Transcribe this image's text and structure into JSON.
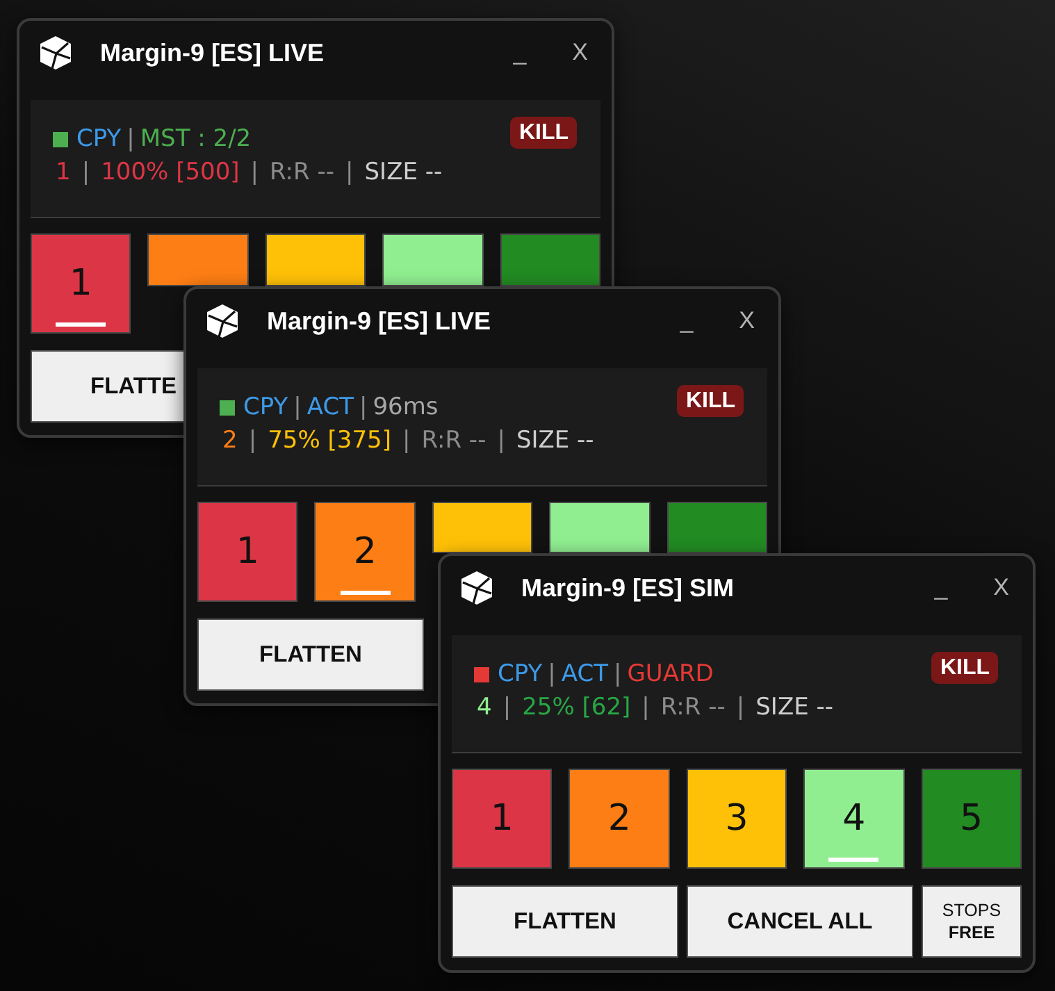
{
  "windows": [
    {
      "title": "Margin-9 [ES] LIVE",
      "minimize": "_",
      "close": "X",
      "status": {
        "color": "#4caf50",
        "line1": [
          {
            "kind": "text",
            "text": "CPY",
            "color": "#3d9ae8"
          },
          {
            "kind": "sep",
            "text": "|",
            "color": "#8c8c8c"
          },
          {
            "kind": "text",
            "text": "MST : 2/2",
            "color": "#4caf50"
          }
        ],
        "line2": [
          {
            "kind": "text",
            "text": "1",
            "color": "#dc3545"
          },
          {
            "kind": "sep",
            "text": "|",
            "color": "#8c8c8c"
          },
          {
            "kind": "text",
            "text": "100% [500]",
            "color": "#dc3545"
          },
          {
            "kind": "sep",
            "text": "|",
            "color": "#8c8c8c"
          },
          {
            "kind": "text",
            "text": "R:R --",
            "color": "#8c8c8c"
          },
          {
            "kind": "sep",
            "text": "|",
            "color": "#8c8c8c"
          },
          {
            "kind": "text",
            "text": "SIZE --",
            "color": "#cfcfcf"
          }
        ],
        "kill": "KILL"
      },
      "levels": [
        {
          "label": "1",
          "color": "#dc3545",
          "selected": true
        },
        {
          "color": "#fd7e14"
        },
        {
          "color": "#ffc107"
        },
        {
          "color": "#90ee90"
        },
        {
          "color": "#228b22"
        }
      ],
      "actions": [
        {
          "label": "FLATTE"
        }
      ]
    },
    {
      "title": "Margin-9 [ES] LIVE",
      "minimize": "_",
      "close": "X",
      "status": {
        "color": "#4caf50",
        "line1": [
          {
            "kind": "text",
            "text": "CPY",
            "color": "#3d9ae8"
          },
          {
            "kind": "sep",
            "text": "|",
            "color": "#8c8c8c"
          },
          {
            "kind": "text",
            "text": "ACT",
            "color": "#3d9ae8"
          },
          {
            "kind": "sep",
            "text": "|",
            "color": "#8c8c8c"
          },
          {
            "kind": "text",
            "text": "96ms",
            "color": "#a6a6a6"
          }
        ],
        "line2": [
          {
            "kind": "text",
            "text": "2",
            "color": "#fd7e14"
          },
          {
            "kind": "sep",
            "text": "|",
            "color": "#8c8c8c"
          },
          {
            "kind": "text",
            "text": "75% [375]",
            "color": "#ffc107"
          },
          {
            "kind": "sep",
            "text": "|",
            "color": "#8c8c8c"
          },
          {
            "kind": "text",
            "text": "R:R --",
            "color": "#8c8c8c"
          },
          {
            "kind": "sep",
            "text": "|",
            "color": "#8c8c8c"
          },
          {
            "kind": "text",
            "text": "SIZE --",
            "color": "#cfcfcf"
          }
        ],
        "kill": "KILL"
      },
      "levels": [
        {
          "label": "1",
          "color": "#dc3545",
          "selected": false
        },
        {
          "label": "2",
          "color": "#fd7e14",
          "selected": true
        },
        {
          "color": "#ffc107"
        },
        {
          "color": "#90ee90"
        },
        {
          "color": "#228b22"
        }
      ],
      "actions": [
        {
          "label": "FLATTEN"
        }
      ]
    },
    {
      "title": "Margin-9 [ES] SIM",
      "minimize": "_",
      "close": "X",
      "status": {
        "color": "#e53935",
        "line1": [
          {
            "kind": "text",
            "text": "CPY",
            "color": "#3d9ae8"
          },
          {
            "kind": "sep",
            "text": "|",
            "color": "#8c8c8c"
          },
          {
            "kind": "text",
            "text": "ACT",
            "color": "#3d9ae8"
          },
          {
            "kind": "sep",
            "text": "|",
            "color": "#8c8c8c"
          },
          {
            "kind": "text",
            "text": "GUARD",
            "color": "#e53935"
          }
        ],
        "line2": [
          {
            "kind": "text",
            "text": "4",
            "color": "#90ee90"
          },
          {
            "kind": "sep",
            "text": "|",
            "color": "#8c8c8c"
          },
          {
            "kind": "text",
            "text": "25% [62]",
            "color": "#28a745"
          },
          {
            "kind": "sep",
            "text": "|",
            "color": "#8c8c8c"
          },
          {
            "kind": "text",
            "text": "R:R --",
            "color": "#8c8c8c"
          },
          {
            "kind": "sep",
            "text": "|",
            "color": "#8c8c8c"
          },
          {
            "kind": "text",
            "text": "SIZE --",
            "color": "#cfcfcf"
          }
        ],
        "kill": "KILL"
      },
      "levels": [
        {
          "label": "1",
          "color": "#dc3545",
          "selected": false
        },
        {
          "label": "2",
          "color": "#fd7e14",
          "selected": false
        },
        {
          "label": "3",
          "color": "#ffc107",
          "selected": false
        },
        {
          "label": "4",
          "color": "#90ee90",
          "selected": true
        },
        {
          "label": "5",
          "color": "#228b22",
          "selected": false
        }
      ],
      "actions": [
        {
          "label": "FLATTEN"
        },
        {
          "label": "CANCEL ALL"
        },
        {
          "label": "STOPS",
          "value": "FREE"
        }
      ]
    }
  ]
}
